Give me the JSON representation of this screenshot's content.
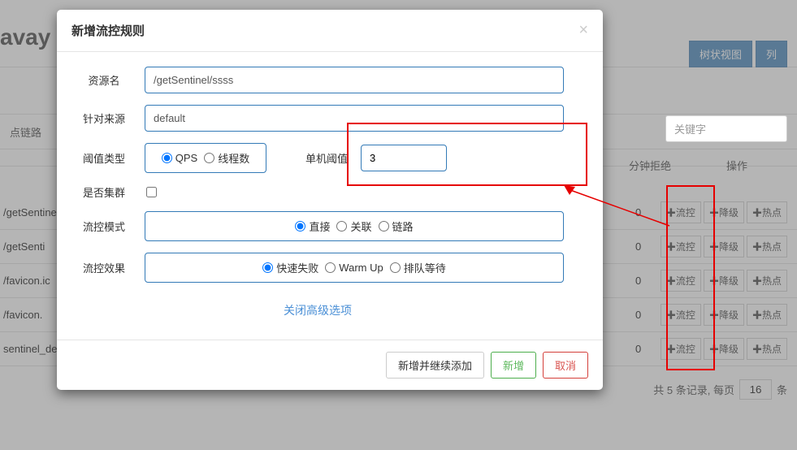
{
  "bg": {
    "title_fragment": "avay",
    "btn_tree": "树状视图",
    "btn_col": "列",
    "link_label": "点链路",
    "keyword_placeholder": "关键字",
    "th_reject": "分钟拒绝",
    "th_ops": "操作",
    "rows": [
      {
        "res": "/getSentinel",
        "reject": "0"
      },
      {
        "res": "/getSenti",
        "reject": "0"
      },
      {
        "res": "/favicon.ic",
        "reject": "0"
      },
      {
        "res": "/favicon.",
        "reject": "0"
      },
      {
        "res": "sentinel_de",
        "reject": "0"
      }
    ],
    "op_flow": "流控",
    "op_degrade": "降级",
    "op_hot": "热点",
    "footer_text": "共 5 条记录, 每页",
    "page_size": "16",
    "footer_suffix": "条"
  },
  "modal": {
    "title": "新增流控规则",
    "label_resource": "资源名",
    "value_resource": "/getSentinel/ssss",
    "label_origin": "针对来源",
    "value_origin": "default",
    "label_threshold_type": "阈值类型",
    "radio_qps": "QPS",
    "radio_threads": "线程数",
    "label_threshold": "单机阈值",
    "value_threshold": "3",
    "label_cluster": "是否集群",
    "label_mode": "流控模式",
    "radio_direct": "直接",
    "radio_relate": "关联",
    "radio_chain": "链路",
    "label_effect": "流控效果",
    "radio_fail": "快速失败",
    "radio_warmup": "Warm Up",
    "radio_queue": "排队等待",
    "advanced": "关闭高级选项",
    "btn_add_continue": "新增并继续添加",
    "btn_add": "新增",
    "btn_cancel": "取消"
  }
}
